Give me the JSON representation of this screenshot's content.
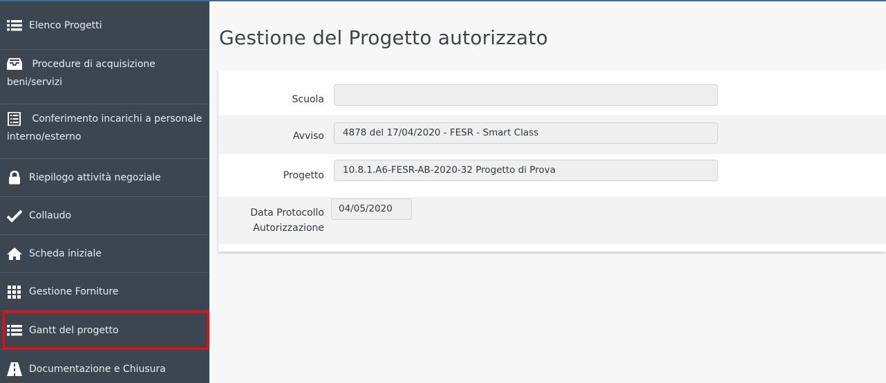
{
  "sidebar": {
    "items": [
      {
        "label": "Elenco Progetti",
        "icon": "list-icon"
      },
      {
        "label": "Procedure di acquisizione beni/servizi",
        "icon": "inbox-icon"
      },
      {
        "label": "Conferimento incarichi a personale interno/esterno",
        "icon": "document-list-icon"
      },
      {
        "label": "Riepilogo attività negoziale",
        "icon": "lock-icon"
      },
      {
        "label": "Collaudo",
        "icon": "check-icon"
      },
      {
        "label": "Scheda iniziale",
        "icon": "home-icon"
      },
      {
        "label": "Gestione Forniture",
        "icon": "grid-icon"
      },
      {
        "label": "Gantt del progetto",
        "icon": "list-icon",
        "active": true
      },
      {
        "label": "Documentazione e Chiusura",
        "icon": "road-icon"
      }
    ]
  },
  "main": {
    "title": "Gestione del Progetto autorizzato",
    "form": {
      "scuola": {
        "label": "Scuola",
        "value": ""
      },
      "avviso": {
        "label": "Avviso",
        "value": "4878 del 17/04/2020 - FESR - Smart Class"
      },
      "progetto": {
        "label": "Progetto",
        "value": "10.8.1.A6-FESR-AB-2020-32 Progetto di Prova"
      },
      "data_protocollo": {
        "label_line1": "Data Protocollo",
        "label_line2": "Autorizzazione",
        "value": "04/05/2020"
      }
    }
  },
  "colors": {
    "sidebar_bg": "#3b4650",
    "active_outline": "#d3141b",
    "top_accent": "#2f6db3"
  }
}
